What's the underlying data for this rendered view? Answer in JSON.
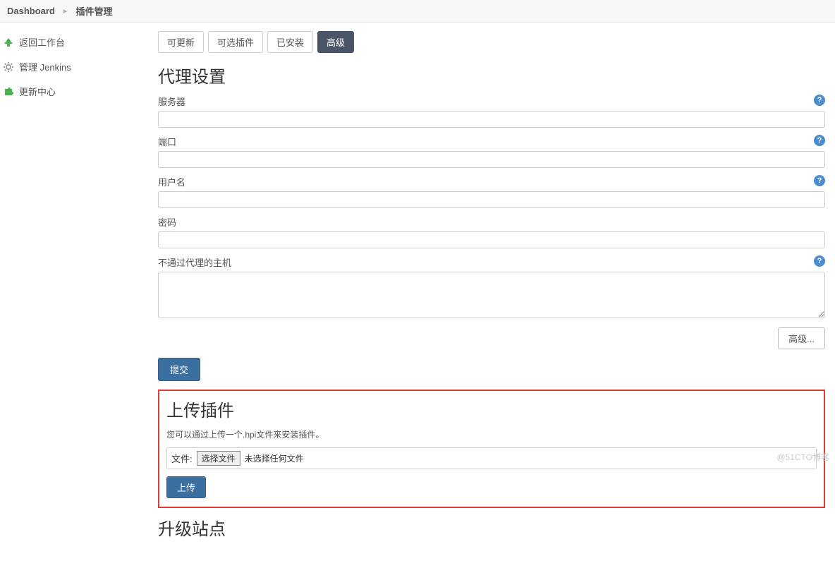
{
  "breadcrumb": {
    "items": [
      "Dashboard",
      "插件管理"
    ]
  },
  "sidebar": {
    "items": [
      {
        "label": "返回工作台",
        "icon": "arrow-up-icon",
        "color": "#4caf50"
      },
      {
        "label": "管理 Jenkins",
        "icon": "gear-icon",
        "color": "#9e9e9e"
      },
      {
        "label": "更新中心",
        "icon": "puzzle-icon",
        "color": "#4caf50"
      }
    ]
  },
  "tabs": {
    "items": [
      {
        "label": "可更新",
        "active": false
      },
      {
        "label": "可选插件",
        "active": false
      },
      {
        "label": "已安装",
        "active": false
      },
      {
        "label": "高级",
        "active": true
      }
    ]
  },
  "proxy": {
    "title": "代理设置",
    "server_label": "服务器",
    "server_value": "",
    "port_label": "端口",
    "port_value": "",
    "user_label": "用户名",
    "user_value": "",
    "password_label": "密码",
    "password_value": "",
    "noproxy_label": "不通过代理的主机",
    "noproxy_value": "",
    "advanced_button": "高级...",
    "submit_button": "提交"
  },
  "upload": {
    "title": "上传插件",
    "description": "您可以通过上传一个.hpi文件来安装插件。",
    "file_label": "文件:",
    "choose_button": "选择文件",
    "no_file_text": "未选择任何文件",
    "upload_button": "上传"
  },
  "updatesite": {
    "title": "升级站点"
  },
  "help_glyph": "?",
  "watermark": "@51CTO博客"
}
